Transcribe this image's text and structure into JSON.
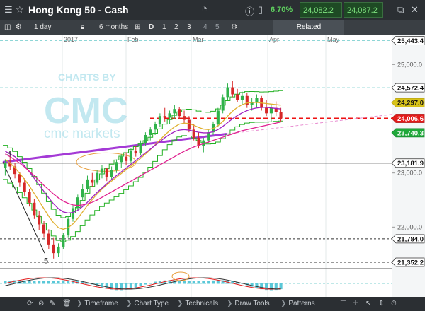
{
  "header": {
    "title": "Hong Kong 50 - Cash",
    "change": "6.70%",
    "sell_price": "24,082.2",
    "buy_price": "24,087.2"
  },
  "toolbar": {
    "interval": "1 day",
    "range": "6 months",
    "chart_style": "D",
    "tool_1": "1",
    "tool_2": "2",
    "tool_3": "3",
    "tool_4": "4",
    "tool_5": "5",
    "related_label": "Related"
  },
  "bottombar": {
    "timeframe": "Timeframe",
    "chart_type": "Chart Type",
    "technicals": "Technicals",
    "draw_tools": "Draw Tools",
    "patterns": "Patterns"
  },
  "watermark": {
    "line1": "CHARTS BY",
    "line2": "cmc markets"
  },
  "colors": {
    "sma_fast": "#e0b030",
    "sma_mid": "#a020c0",
    "sma_slow": "#e0208f",
    "channel": "#22b022",
    "up": "#2fb24a",
    "down": "#d62828",
    "dashed_level": "#e11",
    "gridline": "#7fd0d0"
  },
  "chart_data": {
    "type": "candlestick",
    "x_labels": [
      "2017",
      "Feb",
      "Mar",
      "Apr",
      "May"
    ],
    "ylim": [
      21300,
      25500
    ],
    "y_ticks": [
      "25,000.0",
      "23,000.0",
      "22,000.0"
    ],
    "price_tags": [
      {
        "label": "25,443.4",
        "value": 25443.4,
        "style": "white"
      },
      {
        "label": "24,572.4",
        "value": 24572.4,
        "style": "white"
      },
      {
        "label": "24,297.0",
        "value": 24297.0,
        "style": "yellow"
      },
      {
        "label": "24,006.6",
        "value": 24006.6,
        "style": "red"
      },
      {
        "label": "23,740.3",
        "value": 23740.3,
        "style": "green"
      },
      {
        "label": "23,181.9",
        "value": 23181.9,
        "style": "white"
      },
      {
        "label": "21,784.0",
        "value": 21784.0,
        "style": "white"
      },
      {
        "label": "21,352.2",
        "value": 21352.2,
        "style": "white"
      }
    ],
    "annotations": [
      {
        "label": "4"
      },
      {
        "label": "5"
      }
    ],
    "candles": [
      [
        23100,
        23250,
        22950,
        23180
      ],
      [
        23180,
        23300,
        23050,
        23120
      ],
      [
        23120,
        23180,
        22900,
        22980
      ],
      [
        22980,
        23020,
        22750,
        22820
      ],
      [
        22820,
        22900,
        22580,
        22650
      ],
      [
        22650,
        22700,
        22380,
        22450
      ],
      [
        22450,
        22520,
        22150,
        22220
      ],
      [
        22220,
        22300,
        21950,
        22050
      ],
      [
        22050,
        22120,
        21800,
        21880
      ],
      [
        21880,
        21960,
        21600,
        21680
      ],
      [
        21680,
        21800,
        21420,
        21520
      ],
      [
        21520,
        21700,
        21450,
        21640
      ],
      [
        21640,
        21900,
        21600,
        21850
      ],
      [
        21850,
        22200,
        21800,
        22150
      ],
      [
        22150,
        22400,
        22100,
        22350
      ],
      [
        22350,
        22600,
        22300,
        22550
      ],
      [
        22550,
        22800,
        22500,
        22700
      ],
      [
        22700,
        22950,
        22650,
        22880
      ],
      [
        22880,
        23000,
        22750,
        22820
      ],
      [
        22820,
        23050,
        22780,
        23000
      ],
      [
        23000,
        23150,
        22900,
        23080
      ],
      [
        23080,
        23100,
        22850,
        22920
      ],
      [
        22920,
        23120,
        22880,
        23060
      ],
      [
        23060,
        23250,
        23000,
        23200
      ],
      [
        23200,
        23350,
        23100,
        23300
      ],
      [
        23300,
        23380,
        23150,
        23220
      ],
      [
        23220,
        23450,
        23180,
        23400
      ],
      [
        23400,
        23500,
        23300,
        23360
      ],
      [
        23360,
        23600,
        23320,
        23550
      ],
      [
        23550,
        23750,
        23500,
        23700
      ],
      [
        23700,
        23850,
        23600,
        23800
      ],
      [
        23800,
        23950,
        23700,
        23900
      ],
      [
        23900,
        24100,
        23850,
        24050
      ],
      [
        24050,
        24200,
        23950,
        24020
      ],
      [
        24020,
        24150,
        23900,
        24100
      ],
      [
        24100,
        24250,
        24000,
        24180
      ],
      [
        24180,
        24220,
        24000,
        24050
      ],
      [
        24050,
        24150,
        23900,
        23980
      ],
      [
        23980,
        24050,
        23750,
        23800
      ],
      [
        23800,
        23900,
        23600,
        23650
      ],
      [
        23650,
        23750,
        23450,
        23500
      ],
      [
        23500,
        23650,
        23380,
        23600
      ],
      [
        23600,
        23800,
        23550,
        23750
      ],
      [
        23750,
        23950,
        23700,
        23900
      ],
      [
        23900,
        24200,
        23850,
        24150
      ],
      [
        24150,
        24450,
        24100,
        24400
      ],
      [
        24400,
        24650,
        24350,
        24580
      ],
      [
        24580,
        24700,
        24400,
        24450
      ],
      [
        24450,
        24550,
        24300,
        24350
      ],
      [
        24350,
        24500,
        24250,
        24420
      ],
      [
        24420,
        24480,
        24200,
        24250
      ],
      [
        24250,
        24380,
        24150,
        24300
      ],
      [
        24300,
        24450,
        24220,
        24380
      ],
      [
        24380,
        24420,
        24150,
        24200
      ],
      [
        24200,
        24350,
        24050,
        24100
      ],
      [
        24100,
        24250,
        23950,
        24200
      ],
      [
        24200,
        24320,
        24050,
        24120
      ],
      [
        24120,
        24200,
        23950,
        24006.6
      ]
    ],
    "series": [
      {
        "values": [
          23250,
          23180,
          23100,
          22990,
          22880,
          22760,
          22620,
          22480,
          22340,
          22200,
          22080,
          21990,
          21960,
          21990,
          22060,
          22160,
          22280,
          22400,
          22510,
          22610,
          22700,
          22780,
          22850,
          22920,
          22990,
          23060,
          23130,
          23200,
          23270,
          23350,
          23430,
          23520,
          23610,
          23700,
          23780,
          23850,
          23900,
          23920,
          23910,
          23880,
          23840,
          23810,
          23800,
          23820,
          23870,
          23950,
          24050,
          24140,
          24210,
          24260,
          24290,
          24300,
          24300,
          24290,
          24280,
          24270,
          24260,
          24250
        ]
      },
      {
        "values": [
          23400,
          23350,
          23300,
          23220,
          23130,
          23020,
          22900,
          22780,
          22660,
          22540,
          22430,
          22340,
          22280,
          22260,
          22270,
          22310,
          22380,
          22460,
          22550,
          22640,
          22720,
          22800,
          22880,
          22950,
          23020,
          23090,
          23160,
          23230,
          23300,
          23370,
          23440,
          23510,
          23580,
          23650,
          23710,
          23760,
          23790,
          23800,
          23790,
          23770,
          23750,
          23740,
          23740,
          23760,
          23800,
          23860,
          23930,
          24000,
          24060,
          24110,
          24150,
          24180,
          24200,
          24210,
          24210,
          24200,
          24190,
          24180
        ]
      },
      {
        "values": [
          23350,
          23300,
          23240,
          23180,
          23110,
          23030,
          22950,
          22860,
          22770,
          22690,
          22610,
          22540,
          22480,
          22440,
          22410,
          22400,
          22410,
          22430,
          22460,
          22500,
          22550,
          22600,
          22650,
          22700,
          22750,
          22800,
          22850,
          22900,
          22950,
          23000,
          23050,
          23100,
          23150,
          23200,
          23250,
          23300,
          23350,
          23400,
          23440,
          23480,
          23510,
          23540,
          23570,
          23600,
          23630,
          23660,
          23690,
          23720,
          23750,
          23780,
          23800,
          23820,
          23840,
          23860,
          23880,
          23900,
          23920,
          23940
        ]
      }
    ]
  }
}
